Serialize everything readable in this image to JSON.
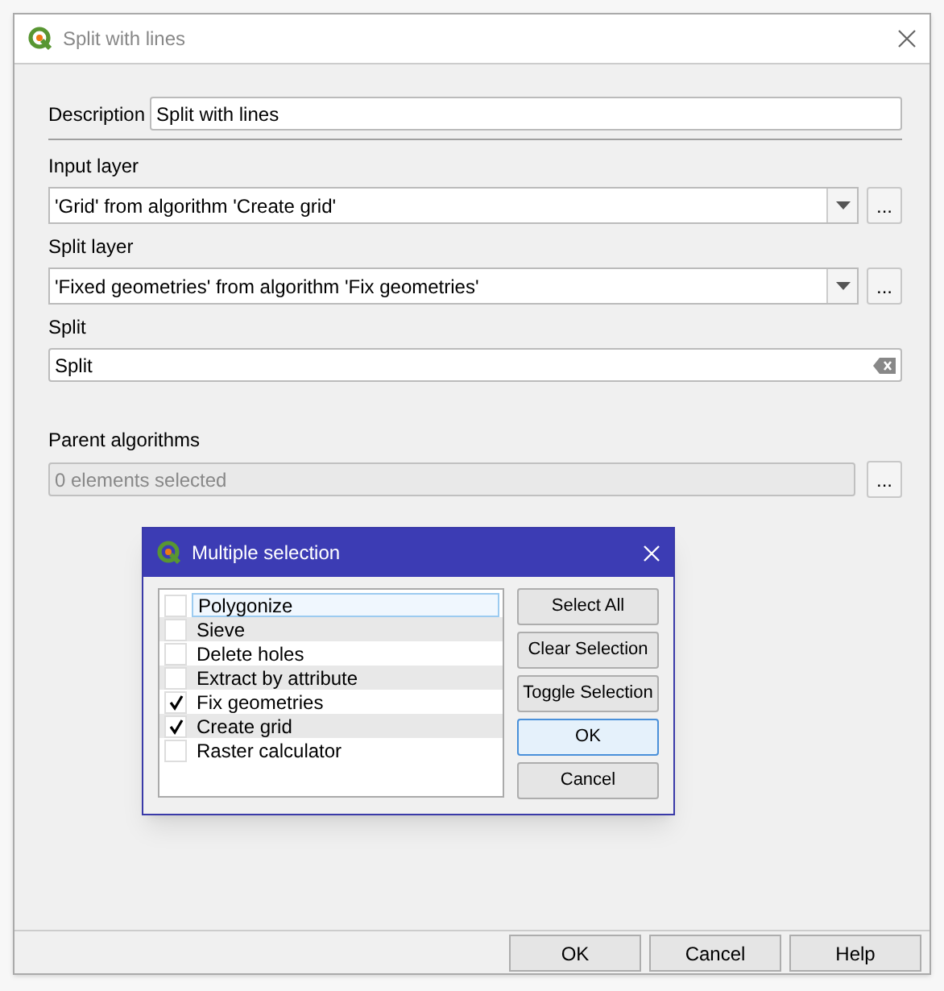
{
  "window": {
    "title": "Split with lines"
  },
  "description": {
    "label": "Description",
    "value": "Split with lines"
  },
  "input_layer": {
    "label": "Input layer",
    "value": "'Grid' from algorithm 'Create grid'",
    "browse": "..."
  },
  "split_layer": {
    "label": "Split layer",
    "value": "'Fixed geometries' from algorithm 'Fix geometries'",
    "browse": "..."
  },
  "split": {
    "label": "Split",
    "value": "Split"
  },
  "parent_algorithms": {
    "label": "Parent algorithms",
    "value": "0 elements selected",
    "browse": "..."
  },
  "buttons": [
    "OK",
    "Cancel",
    "Help"
  ],
  "selection_dialog": {
    "title": "Multiple selection",
    "items": [
      {
        "label": "Polygonize",
        "checked": false,
        "selected": true
      },
      {
        "label": "Sieve",
        "checked": false,
        "selected": false
      },
      {
        "label": "Delete holes",
        "checked": false,
        "selected": false
      },
      {
        "label": "Extract by attribute",
        "checked": false,
        "selected": false
      },
      {
        "label": "Fix geometries",
        "checked": true,
        "selected": false
      },
      {
        "label": "Create grid",
        "checked": true,
        "selected": false
      },
      {
        "label": "Raster calculator",
        "checked": false,
        "selected": false
      }
    ],
    "buttons": [
      {
        "label": "Select All",
        "default": false
      },
      {
        "label": "Clear Selection",
        "default": false
      },
      {
        "label": "Toggle Selection",
        "default": false
      },
      {
        "label": "OK",
        "default": true
      },
      {
        "label": "Cancel",
        "default": false
      }
    ]
  }
}
